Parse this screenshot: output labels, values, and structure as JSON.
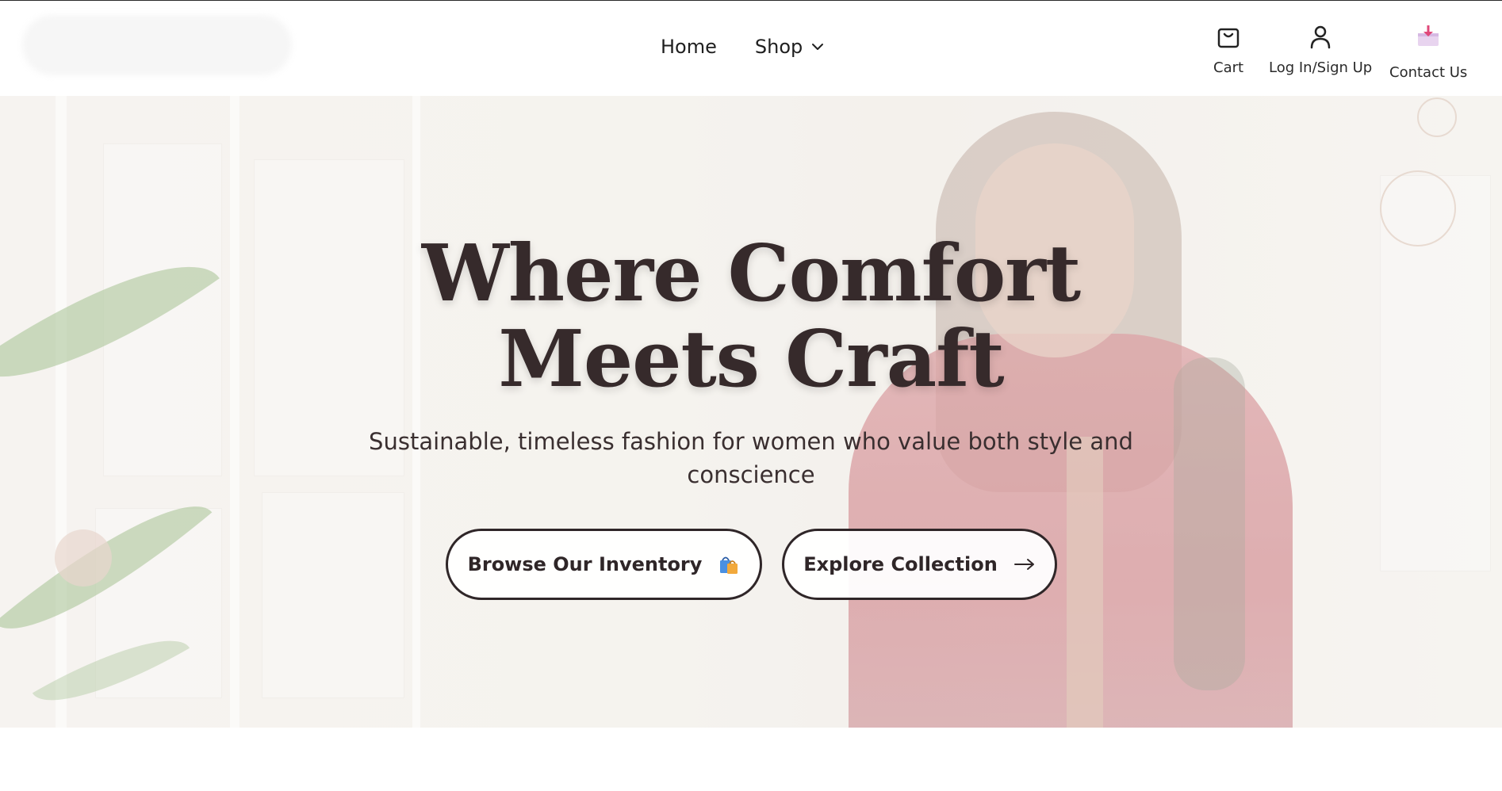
{
  "nav": {
    "home_label": "Home",
    "shop_label": "Shop"
  },
  "utility": {
    "cart_label": "Cart",
    "login_label": "Log In/Sign Up",
    "contact_label": "Contact Us"
  },
  "hero": {
    "title_line1": "Where Comfort",
    "title_line2": "Meets Craft",
    "subtitle": "Sustainable, timeless fashion for women who value both style and conscience",
    "buttons": [
      {
        "label": "Browse Our Inventory",
        "icon": "shopping-bags-icon"
      },
      {
        "label": "Explore Collection",
        "icon": "arrow-right-icon"
      }
    ]
  },
  "colors": {
    "title_text": "#362a2b",
    "button_border": "#2f2628",
    "dress_accent": "#c66c74",
    "contact_icon_accent": "#e0487a"
  }
}
